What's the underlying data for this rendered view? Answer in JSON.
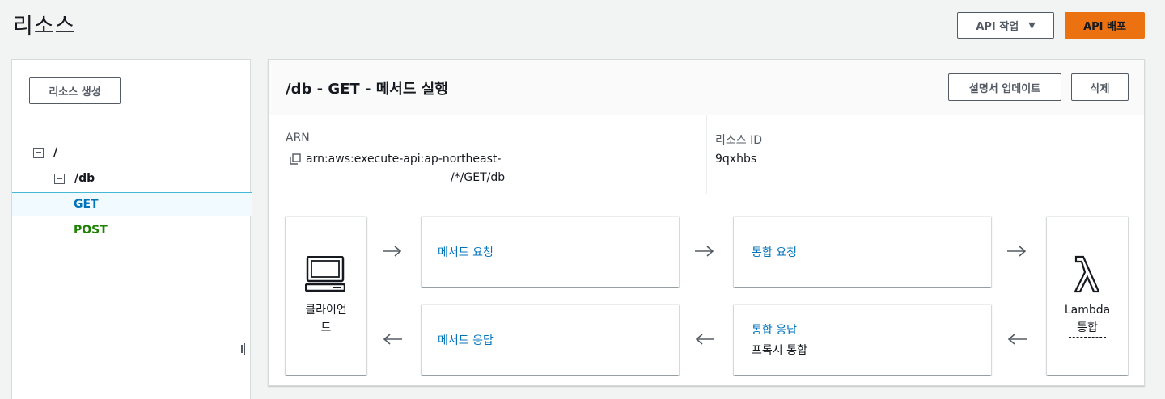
{
  "page": {
    "title": "리소스"
  },
  "toolbar": {
    "actions_label": "API 작업",
    "deploy_label": "API 배포"
  },
  "sidebar": {
    "create_resource_label": "리소스 생성",
    "tree": [
      {
        "label": "/",
        "type": "resource"
      },
      {
        "label": "/db",
        "type": "resource"
      },
      {
        "label": "GET",
        "type": "method",
        "selected": true
      },
      {
        "label": "POST",
        "type": "method"
      }
    ]
  },
  "main": {
    "title": "/db - GET - 메서드 실행",
    "update_docs_label": "설명서 업데이트",
    "delete_label": "삭제",
    "arn_label": "ARN",
    "arn_line1": "arn:aws:execute-api:ap-northeast-",
    "arn_line2": "/*/GET/db",
    "resource_id_label": "리소스 ID",
    "resource_id_value": "9qxhbs"
  },
  "flow": {
    "client_line1": "클라이언",
    "client_line2": "트",
    "method_request": "메서드 요청",
    "integration_request": "통합 요청",
    "method_response": "메서드 응답",
    "integration_response": "통합 응답",
    "integration_response_sub": "프록시 통합",
    "lambda_line1": "Lambda",
    "lambda_line2": "통합"
  },
  "colors": {
    "accent": "#ec7211",
    "link": "#0073bb",
    "post": "#1d8102",
    "selected_border": "#44b9d6"
  }
}
